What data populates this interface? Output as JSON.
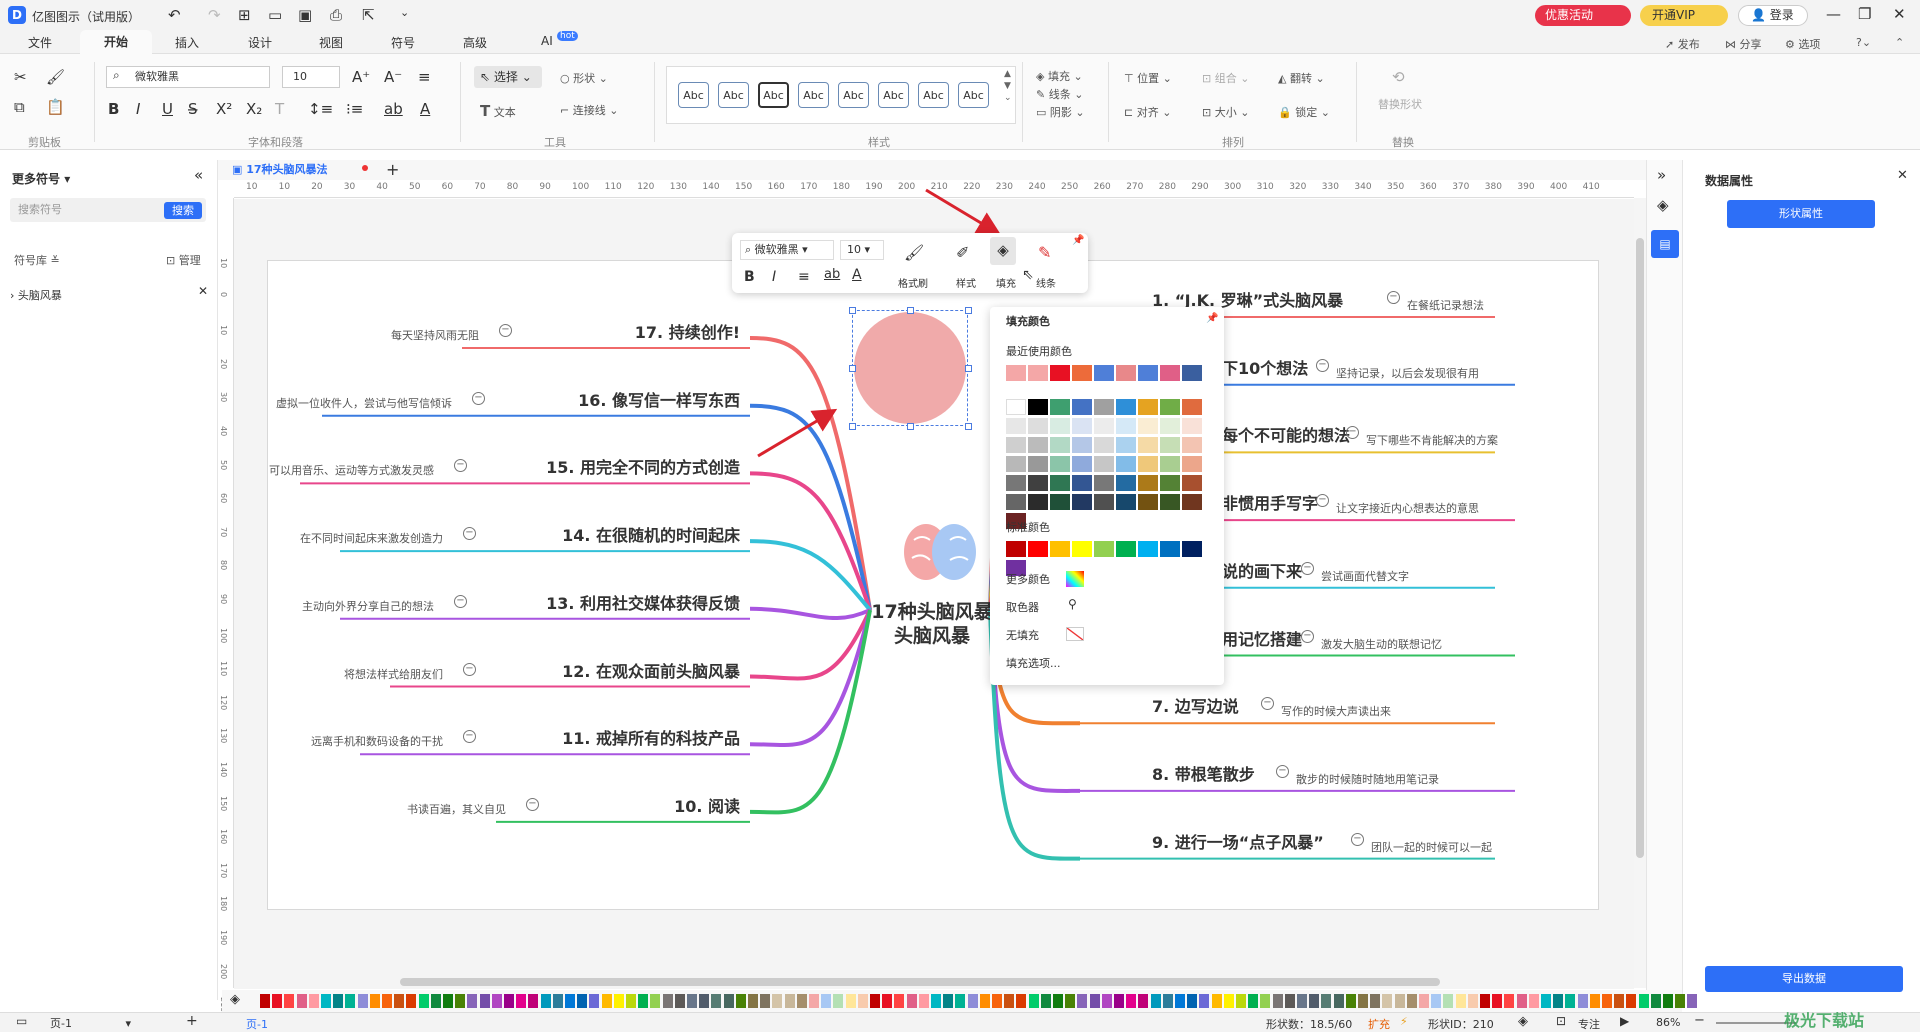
{
  "app": {
    "title": "亿图图示（试用版）",
    "promo": "优惠活动",
    "vip": "开通VIP",
    "login": "登录"
  },
  "menu": {
    "tabs": [
      "文件",
      "开始",
      "插入",
      "设计",
      "视图",
      "符号",
      "高级",
      "AI"
    ],
    "ai_badge": "hot",
    "active": "开始",
    "right": [
      "发布",
      "分享",
      "选项"
    ]
  },
  "ribbon": {
    "font": "微软雅黑",
    "size": "10",
    "select": "选择",
    "shape": "形状",
    "text": "文本",
    "connector": "连接线",
    "fill": "填充",
    "line": "线条",
    "shadow": "阴影",
    "position": "位置",
    "group": "组合",
    "flip": "翻转",
    "align": "对齐",
    "size_label": "大小",
    "lock": "锁定",
    "replace_shape": "替换形状",
    "abc": [
      "Abc",
      "Abc",
      "Abc",
      "Abc",
      "Abc",
      "Abc",
      "Abc",
      "Abc"
    ],
    "groups": [
      "剪贴板",
      "字体和段落",
      "工具",
      "样式",
      "排列",
      "替换"
    ]
  },
  "left": {
    "title": "更多符号",
    "search_placeholder": "搜索符号",
    "search_btn": "搜索",
    "library": "符号库",
    "manage": "管理",
    "item": "头脑风暴"
  },
  "doc_tab": "17种头脑风暴法",
  "ruler_top": [
    "10",
    "10",
    "20",
    "30",
    "40",
    "50",
    "60",
    "70",
    "80",
    "90",
    "100",
    "110",
    "120",
    "130",
    "140",
    "150",
    "160",
    "170",
    "180",
    "190",
    "200",
    "210",
    "220",
    "230",
    "240",
    "250",
    "260",
    "270",
    "280",
    "290",
    "300",
    "310",
    "320",
    "330",
    "340",
    "350",
    "360",
    "370",
    "380",
    "390",
    "400",
    "410"
  ],
  "ruler_left": [
    "10",
    "0",
    "10",
    "20",
    "30",
    "40",
    "50",
    "60",
    "70",
    "80",
    "90",
    "100",
    "110",
    "120",
    "130",
    "140",
    "150",
    "160",
    "170",
    "180",
    "190",
    "200",
    "210"
  ],
  "floating": {
    "font": "微软雅黑",
    "size": "10",
    "format_brush": "格式刷",
    "style": "样式",
    "fill": "填充",
    "line": "线条"
  },
  "fill_menu": {
    "title": "填充颜色",
    "recent": "最近使用颜色",
    "standard": "标准颜色",
    "more": "更多颜色",
    "picker": "取色器",
    "nofill": "无填充",
    "options": "填充选项...",
    "recent_colors": [
      "#f4a7a7",
      "#f4a7a7",
      "#e81123",
      "#ed6b3a",
      "#4f7fd8",
      "#e8888a",
      "#4f7fd8",
      "#e05f87",
      "#3a5f9f"
    ],
    "standard_colors": [
      "#c00000",
      "#ff0000",
      "#ffc000",
      "#ffff00",
      "#92d050",
      "#00b050",
      "#00b0f0",
      "#0070c0",
      "#002060",
      "#7030a0"
    ],
    "theme_top": [
      "#ffffff",
      "#000000",
      "#3e9f6f",
      "#4472c4",
      "#a0a0a0",
      "#2e8fd8",
      "#e5a321",
      "#70ad47",
      "#e06b3e",
      "#d64545"
    ]
  },
  "mindmap": {
    "center": [
      "17种头脑风暴",
      "头脑风暴"
    ],
    "left": [
      {
        "title": "17. 持续创作!",
        "note": "每天坚持风雨无阻",
        "color": "#f06a6a"
      },
      {
        "title": "16. 像写信一样写东西",
        "note": "虚拟一位收件人，尝试与他写信倾诉",
        "color": "#3a7be0"
      },
      {
        "title": "15. 用完全不同的方式创造",
        "note": "可以用音乐、运动等方式激发灵感",
        "color": "#e8468b"
      },
      {
        "title": "14. 在很随机的时间起床",
        "note": "在不同时间起床来激发创造力",
        "color": "#33c0d8"
      },
      {
        "title": "13. 利用社交媒体获得反馈",
        "note": "主动向外界分享自己的想法",
        "color": "#a855e0"
      },
      {
        "title": "12. 在观众面前头脑风暴",
        "note": "将想法样式给朋友们",
        "color": "#e8468b"
      },
      {
        "title": "11. 戒掉所有的科技产品",
        "note": "远离手机和数码设备的干扰",
        "color": "#a855e0"
      },
      {
        "title": "10. 阅读",
        "note": "书读百遍，其义自见",
        "color": "#33c060"
      }
    ],
    "right": [
      {
        "title": "1. “J.K. 罗琳”式头脑风暴",
        "note": "在餐纸记录想法",
        "color": "#f06a6a"
      },
      {
        "title": "下10个想法",
        "note": "坚持记录，以后会发现很有用",
        "color": "#3a7be0"
      },
      {
        "title": "每个不可能的想法",
        "note": "写下哪些不肯能解决的方案",
        "color": "#e8c030"
      },
      {
        "title": "非惯用手写字",
        "note": "让文字接近内心想表达的意思",
        "color": "#e8468b"
      },
      {
        "title": "说的画下来",
        "note": "尝试画面代替文字",
        "color": "#33c0d8"
      },
      {
        "title": "用记忆搭建",
        "note": "激发大脑生动的联想记忆",
        "color": "#33c060"
      },
      {
        "title": "7. 边写边说",
        "note": "写作的时候大声读出来",
        "color": "#f08030"
      },
      {
        "title": "8. 带根笔散步",
        "note": "散步的时候随时随地用笔记录",
        "color": "#a855e0"
      },
      {
        "title": "9. 进行一场“点子风暴”",
        "note": "团队一起的时候可以一起",
        "color": "#33c0b0"
      }
    ]
  },
  "right_panel": {
    "title": "数据属性",
    "shape_btn": "形状属性",
    "export_btn": "导出数据"
  },
  "status": {
    "page_sel": "页-1",
    "page_tab": "页-1",
    "shapes": "形状数：18.5/60",
    "expand": "扩充",
    "shape_id": "形状ID：210",
    "focus": "专注",
    "zoom": "86%"
  },
  "watermark": "极光下载站"
}
